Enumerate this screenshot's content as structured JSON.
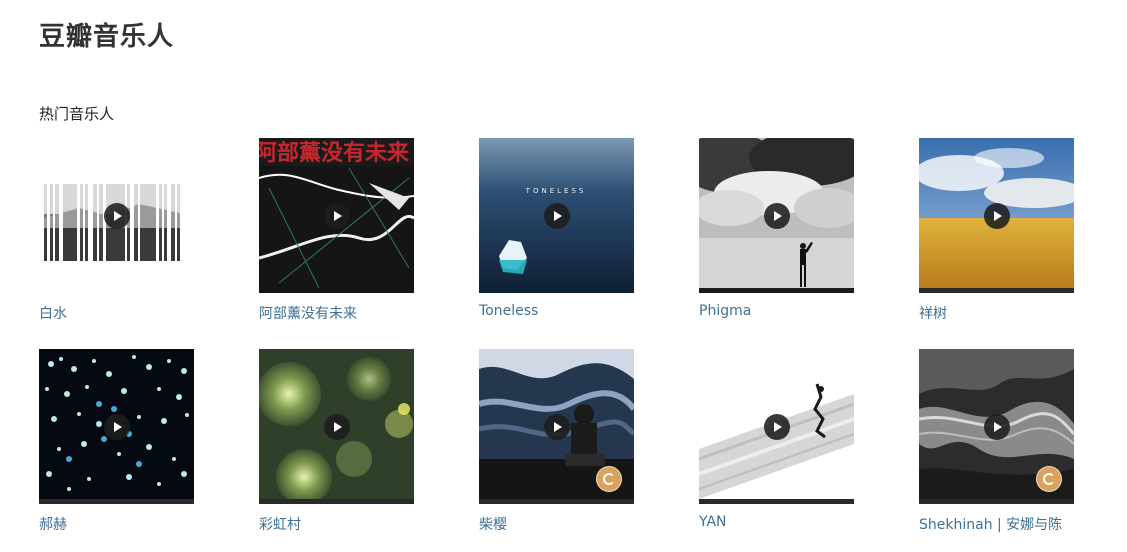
{
  "header": {
    "title": "豆瓣音乐人"
  },
  "section": {
    "title": "热门音乐人"
  },
  "artists": [
    {
      "name": "白水",
      "icon": "play-icon",
      "badge": false
    },
    {
      "name": "阿部薰没有未来",
      "cover_text": "阿部薰没有未来",
      "icon": "play-icon",
      "badge": false
    },
    {
      "name": "Toneless",
      "cover_text": "TONELESS",
      "icon": "play-icon",
      "badge": false
    },
    {
      "name": "Phigma",
      "icon": "play-icon",
      "badge": false
    },
    {
      "name": "祥树",
      "icon": "play-icon",
      "badge": false
    },
    {
      "name": "郝赫",
      "icon": "play-icon",
      "badge": false
    },
    {
      "name": "彩虹村",
      "icon": "play-icon",
      "badge": false
    },
    {
      "name": "柴樱",
      "icon": "play-icon",
      "badge": true,
      "badge_icon": "musician-badge-icon"
    },
    {
      "name": "YAN",
      "icon": "play-icon",
      "badge": false
    },
    {
      "name": "Shekhinah | 安娜与陈",
      "icon": "play-icon",
      "badge": true,
      "badge_icon": "musician-badge-icon"
    }
  ],
  "colors": {
    "link": "#3f7096",
    "title": "#333333",
    "badge": "#d9a35f"
  }
}
